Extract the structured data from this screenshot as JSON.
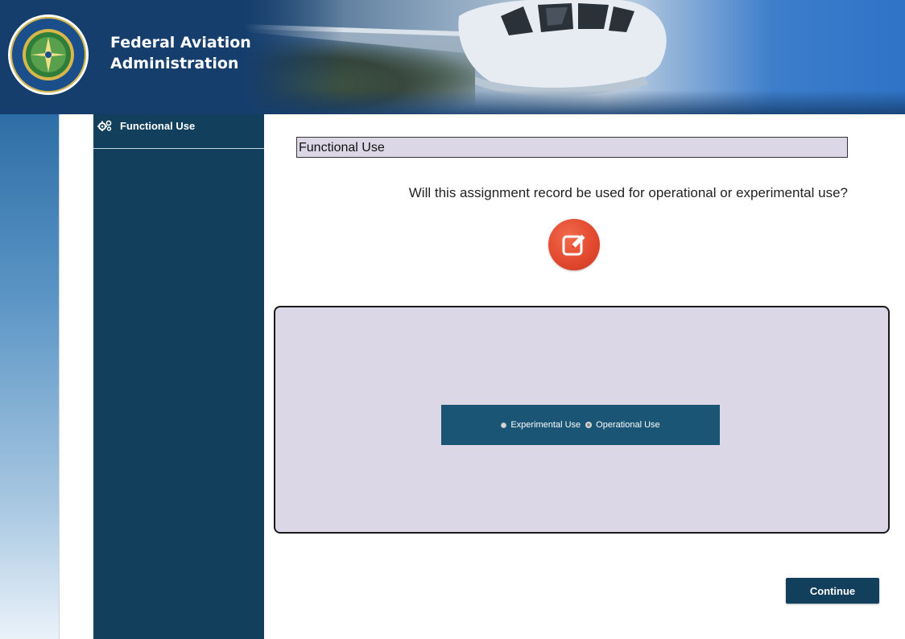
{
  "header": {
    "agency_line1": "Federal Aviation",
    "agency_line2": "Administration",
    "logo_icon": "faa-seal-icon",
    "banner_image": "airplane-cockpit-photo"
  },
  "sidebar": {
    "items": [
      {
        "label": "Functional Use",
        "icon": "gears-icon"
      }
    ]
  },
  "main": {
    "section_title": "Functional Use",
    "question": "Will this assignment record be used for operational or experimental use?",
    "edit_icon": "edit-pencil-icon",
    "options": [
      {
        "label": "Experimental Use",
        "selected": false
      },
      {
        "label": "Operational Use",
        "selected": true
      }
    ],
    "continue_label": "Continue"
  },
  "colors": {
    "header_blue": "#163e6d",
    "sidebar_navy": "#123f5c",
    "panel_lavender": "#dcd7e7",
    "radio_bar": "#1a5576",
    "edit_red": "#e34a2f"
  }
}
